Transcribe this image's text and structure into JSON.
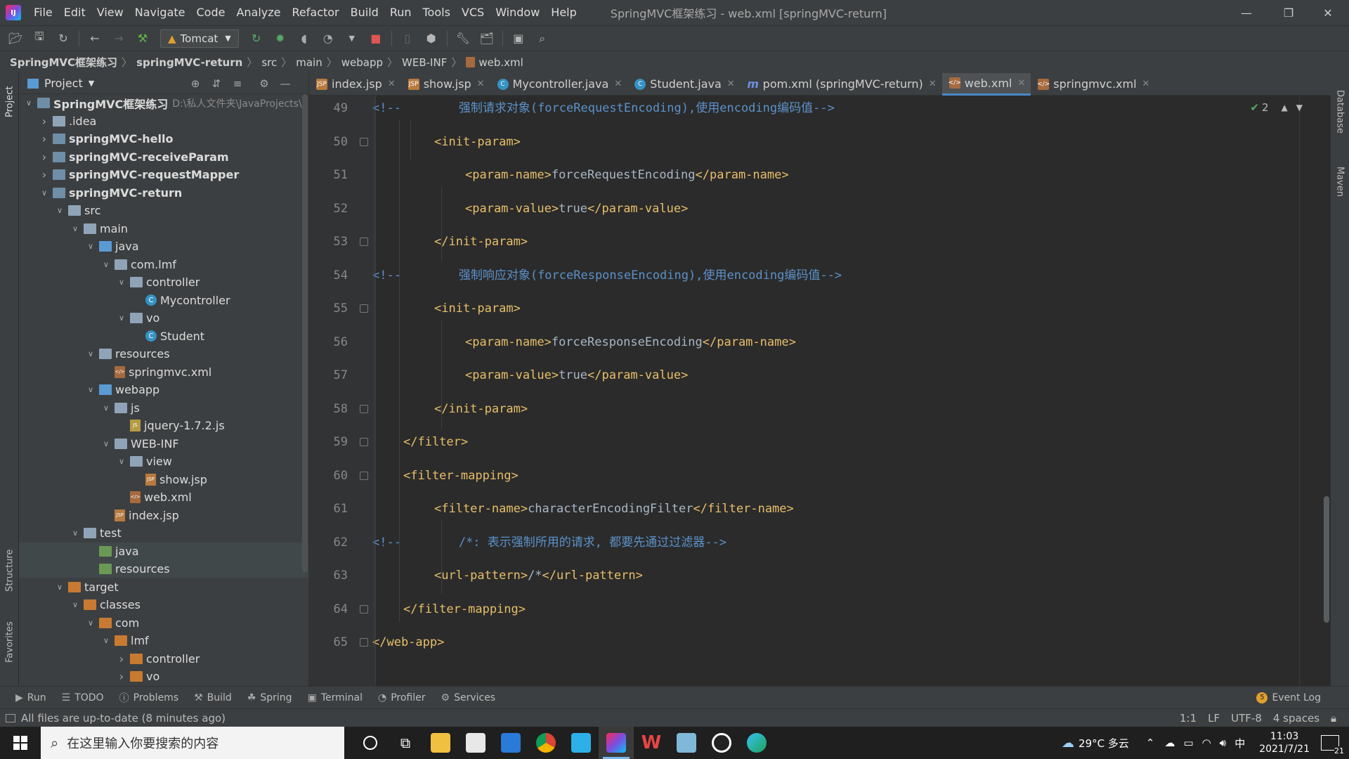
{
  "menubar": {
    "items": [
      "File",
      "Edit",
      "View",
      "Navigate",
      "Code",
      "Analyze",
      "Refactor",
      "Build",
      "Run",
      "Tools",
      "VCS",
      "Window",
      "Help"
    ],
    "title": "SpringMVC框架练习 - web.xml [springMVC-return]"
  },
  "toolbar": {
    "run_config": "Tomcat"
  },
  "breadcrumb": [
    "SpringMVC框架练习",
    "springMVC-return",
    "src",
    "main",
    "webapp",
    "WEB-INF",
    "web.xml"
  ],
  "left_tools": {
    "project": "Project",
    "structure": "Structure",
    "favorites": "Favorites"
  },
  "right_tools": {
    "database": "Database",
    "maven": "Maven"
  },
  "project_panel": {
    "title": "Project",
    "tree": [
      {
        "label": "SpringMVC框架练习",
        "path": "D:\\私人文件夹\\JavaProjects\\S",
        "depth": 0,
        "open": true,
        "icon": "module-folder",
        "bold": true
      },
      {
        "label": ".idea",
        "depth": 1,
        "open": false,
        "icon": "folder"
      },
      {
        "label": "springMVC-hello",
        "depth": 1,
        "open": false,
        "icon": "module-folder",
        "bold": true
      },
      {
        "label": "springMVC-receiveParam",
        "depth": 1,
        "open": false,
        "icon": "module-folder",
        "bold": true
      },
      {
        "label": "springMVC-requestMapper",
        "depth": 1,
        "open": false,
        "icon": "module-folder",
        "bold": true
      },
      {
        "label": "springMVC-return",
        "depth": 1,
        "open": true,
        "icon": "module-folder",
        "bold": true
      },
      {
        "label": "src",
        "depth": 2,
        "open": true,
        "icon": "folder"
      },
      {
        "label": "main",
        "depth": 3,
        "open": true,
        "icon": "folder"
      },
      {
        "label": "java",
        "depth": 4,
        "open": true,
        "icon": "source-folder"
      },
      {
        "label": "com.lmf",
        "depth": 5,
        "open": true,
        "icon": "package"
      },
      {
        "label": "controller",
        "depth": 6,
        "open": true,
        "icon": "package"
      },
      {
        "label": "Mycontroller",
        "depth": 7,
        "icon": "class"
      },
      {
        "label": "vo",
        "depth": 6,
        "open": true,
        "icon": "package"
      },
      {
        "label": "Student",
        "depth": 7,
        "icon": "class"
      },
      {
        "label": "resources",
        "depth": 4,
        "open": true,
        "icon": "resources-folder"
      },
      {
        "label": "springmvc.xml",
        "depth": 5,
        "icon": "xml"
      },
      {
        "label": "webapp",
        "depth": 4,
        "open": true,
        "icon": "web-folder"
      },
      {
        "label": "js",
        "depth": 5,
        "open": true,
        "icon": "folder"
      },
      {
        "label": "jquery-1.7.2.js",
        "depth": 6,
        "icon": "js"
      },
      {
        "label": "WEB-INF",
        "depth": 5,
        "open": true,
        "icon": "folder"
      },
      {
        "label": "view",
        "depth": 6,
        "open": true,
        "icon": "folder"
      },
      {
        "label": "show.jsp",
        "depth": 7,
        "icon": "jsp"
      },
      {
        "label": "web.xml",
        "depth": 6,
        "icon": "xml"
      },
      {
        "label": "index.jsp",
        "depth": 5,
        "icon": "jsp"
      },
      {
        "label": "test",
        "depth": 3,
        "open": true,
        "icon": "folder"
      },
      {
        "label": "java",
        "depth": 4,
        "icon": "test-folder",
        "highlight": true
      },
      {
        "label": "resources",
        "depth": 4,
        "icon": "test-resources-folder",
        "highlight": true
      },
      {
        "label": "target",
        "depth": 2,
        "open": true,
        "icon": "excluded-folder"
      },
      {
        "label": "classes",
        "depth": 3,
        "open": true,
        "icon": "excluded-folder"
      },
      {
        "label": "com",
        "depth": 4,
        "open": true,
        "icon": "excluded-folder"
      },
      {
        "label": "lmf",
        "depth": 5,
        "open": true,
        "icon": "excluded-folder"
      },
      {
        "label": "controller",
        "depth": 6,
        "open": false,
        "icon": "excluded-folder"
      },
      {
        "label": "vo",
        "depth": 6,
        "open": false,
        "icon": "excluded-folder"
      },
      {
        "label": "springmvc.xml",
        "depth": 5,
        "icon": "xml"
      }
    ]
  },
  "tabs": [
    {
      "label": "index.jsp",
      "icon": "jsp",
      "active": false
    },
    {
      "label": "show.jsp",
      "icon": "jsp",
      "active": false
    },
    {
      "label": "Mycontroller.java",
      "icon": "class",
      "active": false
    },
    {
      "label": "Student.java",
      "icon": "class",
      "active": false
    },
    {
      "label": "pom.xml (springMVC-return)",
      "icon": "maven",
      "active": false
    },
    {
      "label": "web.xml",
      "icon": "xml",
      "active": true
    },
    {
      "label": "springmvc.xml",
      "icon": "xml",
      "active": false
    }
  ],
  "editor": {
    "check_count": "2",
    "lines": [
      {
        "num": "49",
        "indent": 0,
        "parts": [
          {
            "t": "<!--",
            "c": "cmtd"
          },
          {
            "t": "        强制请求对象(forceRequestEncoding),使用encoding编码值-->",
            "c": "cmtd"
          }
        ]
      },
      {
        "num": "50",
        "indent": 2,
        "parts": [
          {
            "t": "<init-param>",
            "c": "tag"
          }
        ]
      },
      {
        "num": "51",
        "indent": 3,
        "parts": [
          {
            "t": "<param-name>",
            "c": "tag"
          },
          {
            "t": "forceRequestEncoding",
            "c": "txt"
          },
          {
            "t": "</param-name>",
            "c": "tag"
          }
        ]
      },
      {
        "num": "52",
        "indent": 3,
        "parts": [
          {
            "t": "<param-value>",
            "c": "tag"
          },
          {
            "t": "true",
            "c": "txt"
          },
          {
            "t": "</param-value>",
            "c": "tag"
          }
        ]
      },
      {
        "num": "53",
        "indent": 2,
        "parts": [
          {
            "t": "</init-param>",
            "c": "tag"
          }
        ]
      },
      {
        "num": "54",
        "indent": 0,
        "parts": [
          {
            "t": "<!--",
            "c": "cmtd"
          },
          {
            "t": "        强制响应对象(forceResponseEncoding),使用encoding编码值-->",
            "c": "cmtd"
          }
        ]
      },
      {
        "num": "55",
        "indent": 2,
        "parts": [
          {
            "t": "<init-param>",
            "c": "tag"
          }
        ]
      },
      {
        "num": "56",
        "indent": 3,
        "parts": [
          {
            "t": "<param-name>",
            "c": "tag"
          },
          {
            "t": "forceResponseEncoding",
            "c": "txt"
          },
          {
            "t": "</param-name>",
            "c": "tag"
          }
        ]
      },
      {
        "num": "57",
        "indent": 3,
        "parts": [
          {
            "t": "<param-value>",
            "c": "tag"
          },
          {
            "t": "true",
            "c": "txt"
          },
          {
            "t": "</param-value>",
            "c": "tag"
          }
        ]
      },
      {
        "num": "58",
        "indent": 2,
        "parts": [
          {
            "t": "</init-param>",
            "c": "tag"
          }
        ]
      },
      {
        "num": "59",
        "indent": 1,
        "parts": [
          {
            "t": "</filter>",
            "c": "tag"
          }
        ]
      },
      {
        "num": "60",
        "indent": 1,
        "parts": [
          {
            "t": "<filter-mapping>",
            "c": "tag"
          }
        ]
      },
      {
        "num": "61",
        "indent": 2,
        "parts": [
          {
            "t": "<filter-name>",
            "c": "tag"
          },
          {
            "t": "characterEncodingFilter",
            "c": "txt"
          },
          {
            "t": "</filter-name>",
            "c": "tag"
          }
        ]
      },
      {
        "num": "62",
        "indent": 0,
        "parts": [
          {
            "t": "<!--",
            "c": "cmtd"
          },
          {
            "t": "        /*: 表示强制所用的请求, 都要先通过过滤器-->",
            "c": "cmtd"
          }
        ]
      },
      {
        "num": "63",
        "indent": 2,
        "parts": [
          {
            "t": "<url-pattern>",
            "c": "tag"
          },
          {
            "t": "/*",
            "c": "txt"
          },
          {
            "t": "</url-pattern>",
            "c": "tag"
          }
        ]
      },
      {
        "num": "64",
        "indent": 1,
        "parts": [
          {
            "t": "</filter-mapping>",
            "c": "tag"
          }
        ]
      },
      {
        "num": "65",
        "indent": 0,
        "parts": [
          {
            "t": "</web-app>",
            "c": "tag"
          }
        ]
      }
    ]
  },
  "bottom_tools": [
    "Run",
    "TODO",
    "Problems",
    "Build",
    "Spring",
    "Terminal",
    "Profiler",
    "Services"
  ],
  "event_log": "Event Log",
  "event_count": "5",
  "status": {
    "message": "All files are up-to-date (8 minutes ago)",
    "position": "1:1",
    "line_sep": "LF",
    "encoding": "UTF-8",
    "indent": "4 spaces"
  },
  "taskbar": {
    "search_placeholder": "在这里输入你要搜索的内容",
    "weather": "29°C 多云",
    "ime": "中",
    "time": "11:03",
    "date": "2021/7/21",
    "notif_count": "21"
  },
  "colors": {
    "accent": "#4a88c7",
    "tag": "#e8bf6a",
    "comment": "#5c91c9"
  }
}
